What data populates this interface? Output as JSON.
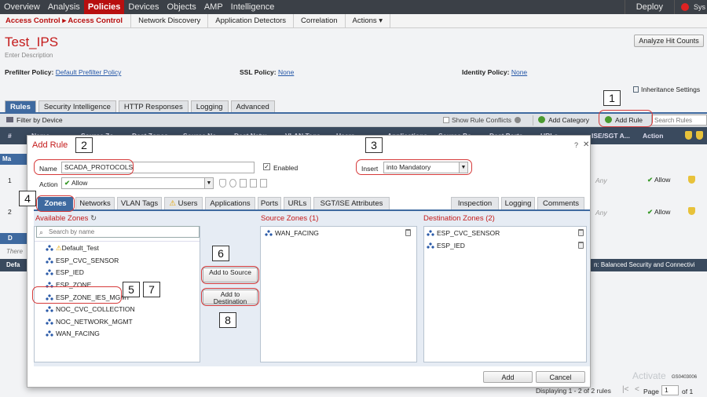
{
  "nav": {
    "items": [
      "Overview",
      "Analysis",
      "Policies",
      "Devices",
      "Objects",
      "AMP",
      "Intelligence"
    ],
    "deploy": "Deploy",
    "system": "Sys"
  },
  "subnav": {
    "crumb": "Access Control ▸ Access Control",
    "items": [
      "Network Discovery",
      "Application Detectors",
      "Correlation",
      "Actions ▾"
    ]
  },
  "policy": {
    "title": "Test_IPS",
    "description": "Enter Description",
    "analyze_btn": "Analyze Hit Counts",
    "prefilter_label": "Prefilter Policy:",
    "prefilter_value": "Default Prefilter Policy",
    "ssl_label": "SSL Policy:",
    "ssl_value": "None",
    "identity_label": "Identity Policy:",
    "identity_value": "None",
    "inheritance": "Inheritance Settings"
  },
  "tabs": [
    "Rules",
    "Security Intelligence",
    "HTTP Responses",
    "Logging",
    "Advanced"
  ],
  "toolbar": {
    "filter": "Filter by Device",
    "show_conflicts": "Show Rule Conflicts",
    "add_category": "Add Category",
    "add_rule": "Add Rule",
    "search_placeholder": "Search Rules"
  },
  "table": {
    "headers": [
      "#",
      "Name",
      "Source Zo",
      "Dest Zones",
      "Source Ne",
      "Dest Netw",
      "VLAN Tags",
      "Users",
      "Applications",
      "Source Po",
      "Dest Ports",
      "URLs",
      "ISE/SGT A...",
      "Action"
    ],
    "rows": [
      {
        "num": "1",
        "any": "Any",
        "action": "Allow"
      },
      {
        "num": "2",
        "any": "Any",
        "action": "Allow"
      }
    ],
    "band1": "Ma",
    "band2": "D",
    "there": "There",
    "default_action_label": "Defa",
    "default_action_value": "n: Balanced Security and Connectivi"
  },
  "modal": {
    "title": "Add Rule",
    "help": "?",
    "close": "✕",
    "name_label": "Name",
    "name_value": "SCADA_PROTOCOLS",
    "enabled_label": "Enabled",
    "insert_label": "Insert",
    "insert_value": "into Mandatory",
    "action_label": "Action",
    "action_value": "Allow",
    "tabs": [
      "Zones",
      "Networks",
      "VLAN Tags",
      "Users",
      "Applications",
      "Ports",
      "URLs",
      "SGT/ISE Attributes"
    ],
    "right_tabs": [
      "Inspection",
      "Logging",
      "Comments"
    ],
    "available_title": "Available Zones",
    "search_placeholder": "Search by name",
    "available_zones": [
      "Default_Test",
      "ESP_CVC_SENSOR",
      "ESP_IED",
      "ESP_ZONE",
      "ESP_ZONE_IES_MGMT",
      "NOC_CVC_COLLECTION",
      "NOC_NETWORK_MGMT",
      "WAN_FACING"
    ],
    "add_source": "Add to Source",
    "add_destination": "Add to Destination",
    "source_title": "Source Zones (1)",
    "source_zones": [
      "WAN_FACING"
    ],
    "dest_title": "Destination Zones (2)",
    "dest_zones": [
      "ESP_CVC_SENSOR",
      "ESP_IED"
    ],
    "add_btn": "Add",
    "cancel_btn": "Cancel"
  },
  "footer": {
    "displaying": "Displaying 1 - 2 of 2 rules",
    "page_label": "Page",
    "page_value": "1",
    "of": "of 1",
    "activate": "Activate",
    "code": "GS0403006"
  },
  "callouts": [
    "1",
    "2",
    "3",
    "4",
    "5",
    "6",
    "7",
    "8"
  ]
}
